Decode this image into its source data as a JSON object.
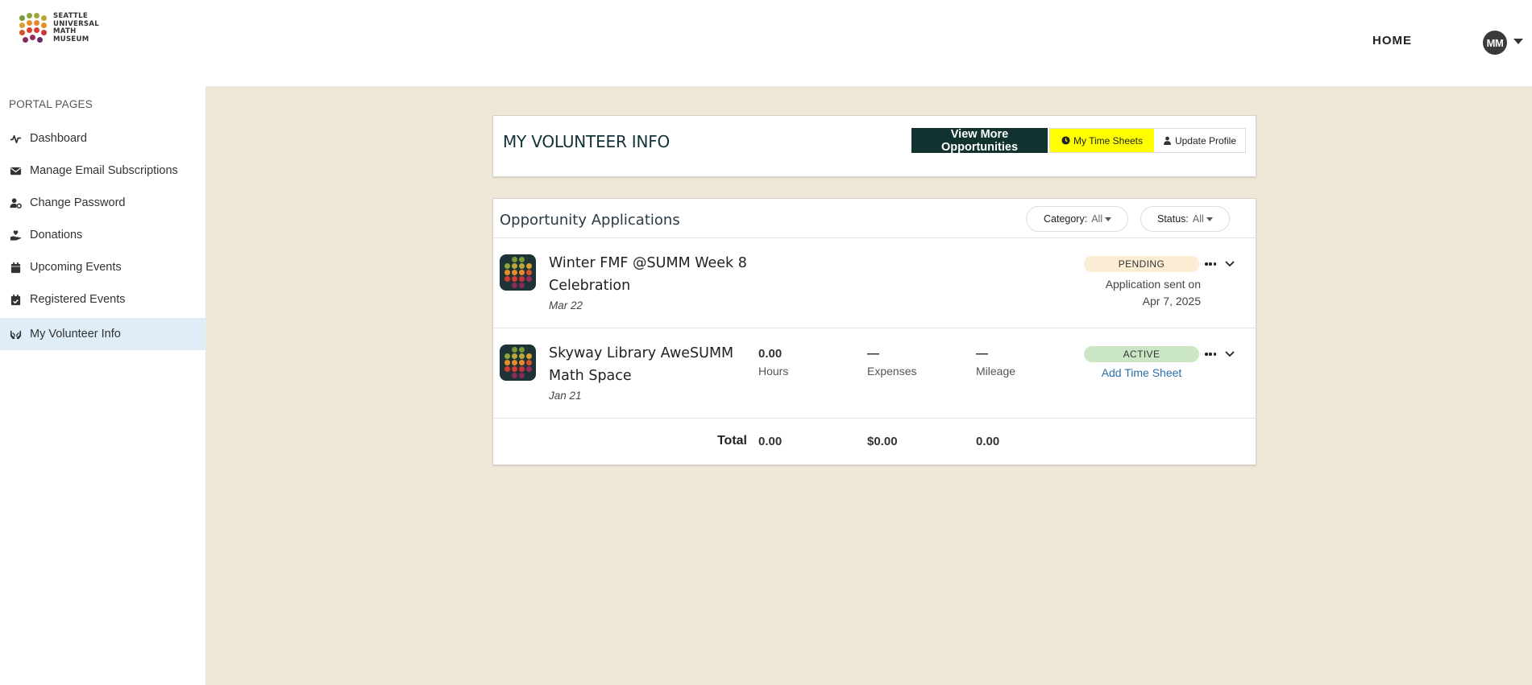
{
  "header": {
    "logo_lines": [
      "SEATTLE",
      "UNIVERSAL",
      "MATH",
      "MUSEUM"
    ],
    "home_label": "HOME",
    "avatar_initials": "MM"
  },
  "sidebar": {
    "heading": "PORTAL PAGES",
    "items": [
      {
        "label": "Dashboard",
        "icon": "activity-icon"
      },
      {
        "label": "Manage Email Subscriptions",
        "icon": "envelope-icon"
      },
      {
        "label": "Change Password",
        "icon": "user-gear-icon"
      },
      {
        "label": "Donations",
        "icon": "hand-holding-heart-icon"
      },
      {
        "label": "Upcoming Events",
        "icon": "calendar-icon"
      },
      {
        "label": "Registered Events",
        "icon": "calendar-check-icon"
      },
      {
        "label": "My Volunteer Info",
        "icon": "hands-icon",
        "active": true
      }
    ]
  },
  "volunteer": {
    "title": "MY VOLUNTEER INFO",
    "view_more_label": "View More Opportunities",
    "time_sheets_label": "My Time Sheets",
    "update_profile_label": "Update Profile"
  },
  "applications": {
    "title": "Opportunity Applications",
    "category_label": "Category:",
    "category_value": "All",
    "status_label": "Status:",
    "status_value": "All",
    "rows": [
      {
        "title": "Winter FMF @SUMM Week 8 Celebration",
        "date": "Mar 22",
        "status": "PENDING",
        "sent_line1": "Application sent on",
        "sent_line2": "Apr 7, 2025"
      },
      {
        "title": "Skyway Library AweSUMM Math Space",
        "date": "Jan 21",
        "status": "ACTIVE",
        "hours_value": "0.00",
        "hours_label": "Hours",
        "expenses_value": "—",
        "expenses_label": "Expenses",
        "mileage_value": "—",
        "mileage_label": "Mileage",
        "action_label": "Add Time Sheet"
      }
    ],
    "totals": {
      "label": "Total",
      "hours": "0.00",
      "expenses": "$0.00",
      "mileage": "0.00"
    }
  },
  "colors": {
    "main_bg": "#efe8d8",
    "accent_dark": "#11322f",
    "highlight": "#ffff00",
    "active_nav": "#deedf8",
    "pending_badge": "#fbecd4",
    "active_badge": "#cbe6c4",
    "link": "#2a6fa8"
  }
}
